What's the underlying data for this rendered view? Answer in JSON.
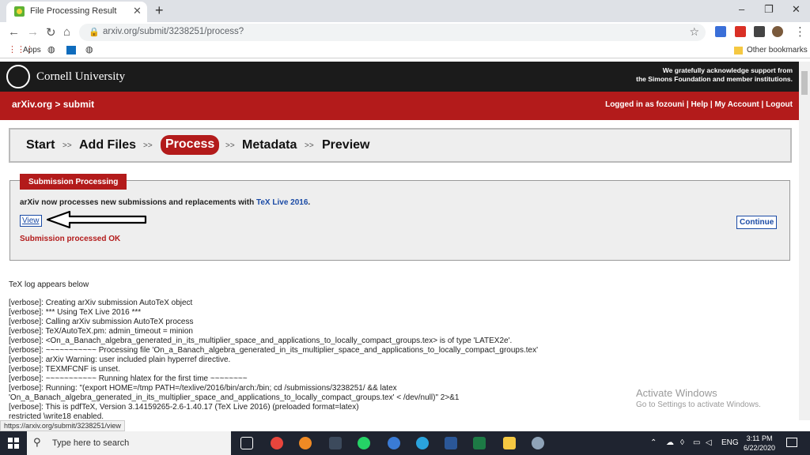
{
  "browser": {
    "tab_title": "File Processing Result",
    "tab_close": "✕",
    "new_tab": "+",
    "url": "arxiv.org/submit/3238251/process?",
    "bookmarks": {
      "apps": "Apps",
      "other": "Other bookmarks"
    },
    "status_url": "https://arxiv.org/submit/3238251/view"
  },
  "header": {
    "university": "Cornell University",
    "ack_line1": "We gratefully acknowledge support from",
    "ack_line2": "the Simons Foundation and member institutions."
  },
  "redbar": {
    "breadcrumb": "arXiv.org > submit",
    "user_links": "Logged in as fozouni | Help | My Account | Logout"
  },
  "steps": {
    "items": [
      "Start",
      "Add Files",
      "Process",
      "Metadata",
      "Preview"
    ],
    "separator": ">>",
    "active": "Process"
  },
  "processing": {
    "tab_label": "Submission Processing",
    "message_prefix": "arXiv now processes new submissions and replacements with",
    "tex_link": "TeX Live 2016",
    "message_suffix": ".",
    "view_label": "View",
    "ok_message": "Submission processed OK",
    "continue_label": "Continue"
  },
  "log": {
    "heading": "TeX log appears below",
    "lines": [
      "[verbose]: Creating arXiv submission AutoTeX object",
      "[verbose]: *** Using TeX Live 2016 ***",
      "[verbose]: Calling arXiv submission AutoTeX process",
      "[verbose]: TeX/AutoTeX.pm: admin_timeout = minion",
      "[verbose]: <On_a_Banach_algebra_generated_in_its_multiplier_space_and_applications_to_locally_compact_groups.tex> is of type 'LATEX2e'.",
      "[verbose]: ~~~~~~~~~~~ Processing file 'On_a_Banach_algebra_generated_in_its_multiplier_space_and_applications_to_locally_compact_groups.tex'",
      "[verbose]: arXiv Warning: user included plain hyperref directive.",
      "[verbose]: TEXMFCNF is unset.",
      "[verbose]: ~~~~~~~~~~~ Running hlatex for the first time ~~~~~~~~",
      "[verbose]: Running: \"(export HOME=/tmp PATH=/texlive/2016/bin/arch:/bin; cd /submissions/3238251/ && latex",
      "'On_a_Banach_algebra_generated_in_its_multiplier_space_and_applications_to_locally_compact_groups.tex' < /dev/null)\" 2>&1",
      "[verbose]: This is pdfTeX, Version 3.14159265-2.6-1.40.17 (TeX Live 2016) (preloaded format=latex)",
      "restricted \\write18 enabled."
    ]
  },
  "watermark": {
    "title": "Activate Windows",
    "subtitle": "Go to Settings to activate Windows."
  },
  "taskbar": {
    "search_placeholder": "Type here to search",
    "lang": "ENG",
    "time": "3:11 PM",
    "date": "6/22/2020"
  }
}
